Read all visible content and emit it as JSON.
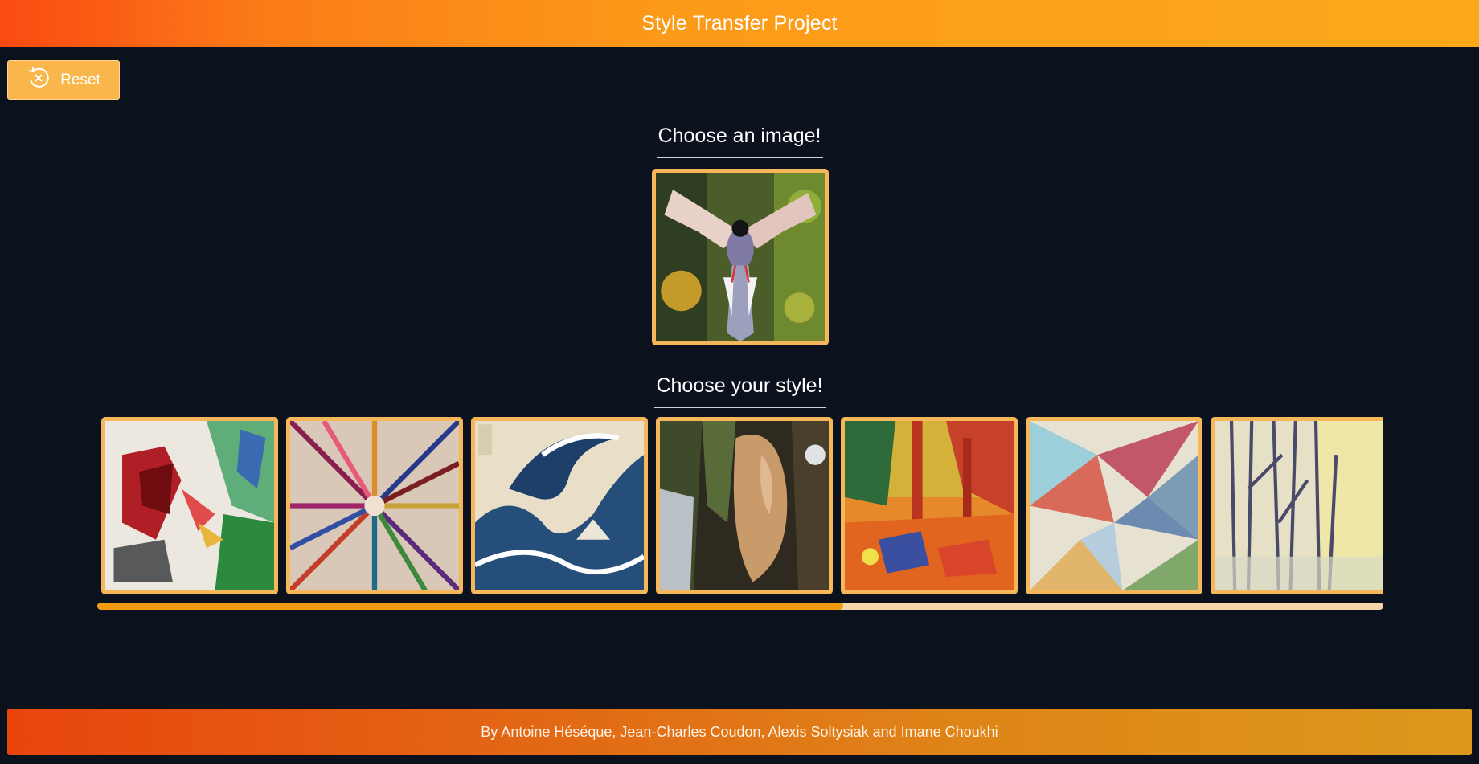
{
  "header": {
    "title": "Style Transfer Project"
  },
  "toolbar": {
    "reset_label": "Reset",
    "reset_icon": "reset-circle-x-icon"
  },
  "content_section": {
    "heading": "Choose an image!",
    "selected_image": "flying-blue-magpie-photo"
  },
  "style_section": {
    "heading": "Choose your style!",
    "styles": [
      {
        "name": "abstract-flower-painting"
      },
      {
        "name": "colorful-burst-painting"
      },
      {
        "name": "great-wave-woodblock"
      },
      {
        "name": "impressionist-landscape"
      },
      {
        "name": "fauvist-forest-painting"
      },
      {
        "name": "cubist-geometric-painting"
      },
      {
        "name": "winter-trees-painting"
      }
    ],
    "scroll_progress": 0.58
  },
  "footer": {
    "credits": "By Antoine Héséque, Jean-Charles Coudon, Alexis Soltysiak and Imane Choukhi"
  },
  "colors": {
    "accent": "#f5b75a",
    "header_start": "#fa4a12",
    "header_end": "#fca81a",
    "background": "#0b111d",
    "scroll_fill": "#f39b10"
  }
}
